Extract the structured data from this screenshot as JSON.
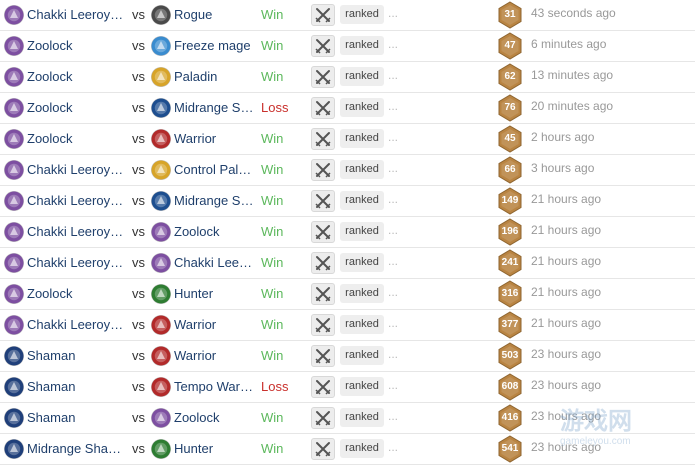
{
  "meta": {
    "row_count": 15
  },
  "colors": {
    "deck_link": "#1f3f6b",
    "win": "#5cb85c",
    "loss": "#c9302c",
    "turns_hex": "#b98442",
    "timestamp": "#999999"
  },
  "classes": {
    "warlock": {
      "icon": "warlock-icon",
      "color": "#7d4fa1"
    },
    "rogue": {
      "icon": "rogue-icon",
      "color": "#4a4a4a"
    },
    "mage": {
      "icon": "mage-icon",
      "color": "#3a8ccf"
    },
    "paladin": {
      "icon": "paladin-icon",
      "color": "#d7a429"
    },
    "druid": {
      "icon": "druid-icon",
      "color": "#1d4e8f"
    },
    "warrior": {
      "icon": "warrior-icon",
      "color": "#b22a2a"
    },
    "hunter": {
      "icon": "hunter-icon",
      "color": "#2e7d32"
    },
    "shaman": {
      "icon": "shaman-icon",
      "color": "#1f3f7a"
    }
  },
  "matches": [
    {
      "player": {
        "deck": "Chakki Leeroy…",
        "class": "warlock"
      },
      "vs": "vs",
      "opponent": {
        "deck": "Rogue",
        "class": "rogue"
      },
      "result": "Win",
      "mode": "ranked",
      "more": "...",
      "turns": "31",
      "time": "43 seconds ago"
    },
    {
      "player": {
        "deck": "Zoolock",
        "class": "warlock"
      },
      "vs": "vs",
      "opponent": {
        "deck": "Freeze mage",
        "class": "mage"
      },
      "result": "Win",
      "mode": "ranked",
      "more": "...",
      "turns": "47",
      "time": "6 minutes ago"
    },
    {
      "player": {
        "deck": "Zoolock",
        "class": "warlock"
      },
      "vs": "vs",
      "opponent": {
        "deck": "Paladin",
        "class": "paladin"
      },
      "result": "Win",
      "mode": "ranked",
      "more": "...",
      "turns": "62",
      "time": "13 minutes ago"
    },
    {
      "player": {
        "deck": "Zoolock",
        "class": "warlock"
      },
      "vs": "vs",
      "opponent": {
        "deck": "Midrange S…",
        "class": "druid"
      },
      "result": "Loss",
      "mode": "ranked",
      "more": "...",
      "turns": "76",
      "time": "20 minutes ago"
    },
    {
      "player": {
        "deck": "Zoolock",
        "class": "warlock"
      },
      "vs": "vs",
      "opponent": {
        "deck": "Warrior",
        "class": "warrior"
      },
      "result": "Win",
      "mode": "ranked",
      "more": "...",
      "turns": "45",
      "time": "2 hours ago"
    },
    {
      "player": {
        "deck": "Chakki Leeroy…",
        "class": "warlock"
      },
      "vs": "vs",
      "opponent": {
        "deck": "Control Pal…",
        "class": "paladin"
      },
      "result": "Win",
      "mode": "ranked",
      "more": "...",
      "turns": "66",
      "time": "3 hours ago"
    },
    {
      "player": {
        "deck": "Chakki Leeroy…",
        "class": "warlock"
      },
      "vs": "vs",
      "opponent": {
        "deck": "Midrange S…",
        "class": "druid"
      },
      "result": "Win",
      "mode": "ranked",
      "more": "...",
      "turns": "149",
      "time": "21 hours ago"
    },
    {
      "player": {
        "deck": "Chakki Leeroy…",
        "class": "warlock"
      },
      "vs": "vs",
      "opponent": {
        "deck": "Zoolock",
        "class": "warlock"
      },
      "result": "Win",
      "mode": "ranked",
      "more": "...",
      "turns": "196",
      "time": "21 hours ago"
    },
    {
      "player": {
        "deck": "Chakki Leeroy…",
        "class": "warlock"
      },
      "vs": "vs",
      "opponent": {
        "deck": "Chakki Lee…",
        "class": "warlock"
      },
      "result": "Win",
      "mode": "ranked",
      "more": "...",
      "turns": "241",
      "time": "21 hours ago"
    },
    {
      "player": {
        "deck": "Zoolock",
        "class": "warlock"
      },
      "vs": "vs",
      "opponent": {
        "deck": "Hunter",
        "class": "hunter"
      },
      "result": "Win",
      "mode": "ranked",
      "more": "...",
      "turns": "316",
      "time": "21 hours ago"
    },
    {
      "player": {
        "deck": "Chakki Leeroy…",
        "class": "warlock"
      },
      "vs": "vs",
      "opponent": {
        "deck": "Warrior",
        "class": "warrior"
      },
      "result": "Win",
      "mode": "ranked",
      "more": "...",
      "turns": "377",
      "time": "21 hours ago"
    },
    {
      "player": {
        "deck": "Shaman",
        "class": "shaman"
      },
      "vs": "vs",
      "opponent": {
        "deck": "Warrior",
        "class": "warrior"
      },
      "result": "Win",
      "mode": "ranked",
      "more": "...",
      "turns": "503",
      "time": "23 hours ago"
    },
    {
      "player": {
        "deck": "Shaman",
        "class": "shaman"
      },
      "vs": "vs",
      "opponent": {
        "deck": "Tempo War…",
        "class": "warrior"
      },
      "result": "Loss",
      "mode": "ranked",
      "more": "...",
      "turns": "608",
      "time": "23 hours ago"
    },
    {
      "player": {
        "deck": "Shaman",
        "class": "shaman"
      },
      "vs": "vs",
      "opponent": {
        "deck": "Zoolock",
        "class": "warlock"
      },
      "result": "Win",
      "mode": "ranked",
      "more": "...",
      "turns": "416",
      "time": "23 hours ago"
    },
    {
      "player": {
        "deck": "Midrange Sha…",
        "class": "shaman"
      },
      "vs": "vs",
      "opponent": {
        "deck": "Hunter",
        "class": "hunter"
      },
      "result": "Win",
      "mode": "ranked",
      "more": "...",
      "turns": "541",
      "time": "23 hours ago"
    }
  ],
  "watermark": {
    "text": "游戏网",
    "subtext": "gameleyou.com"
  }
}
